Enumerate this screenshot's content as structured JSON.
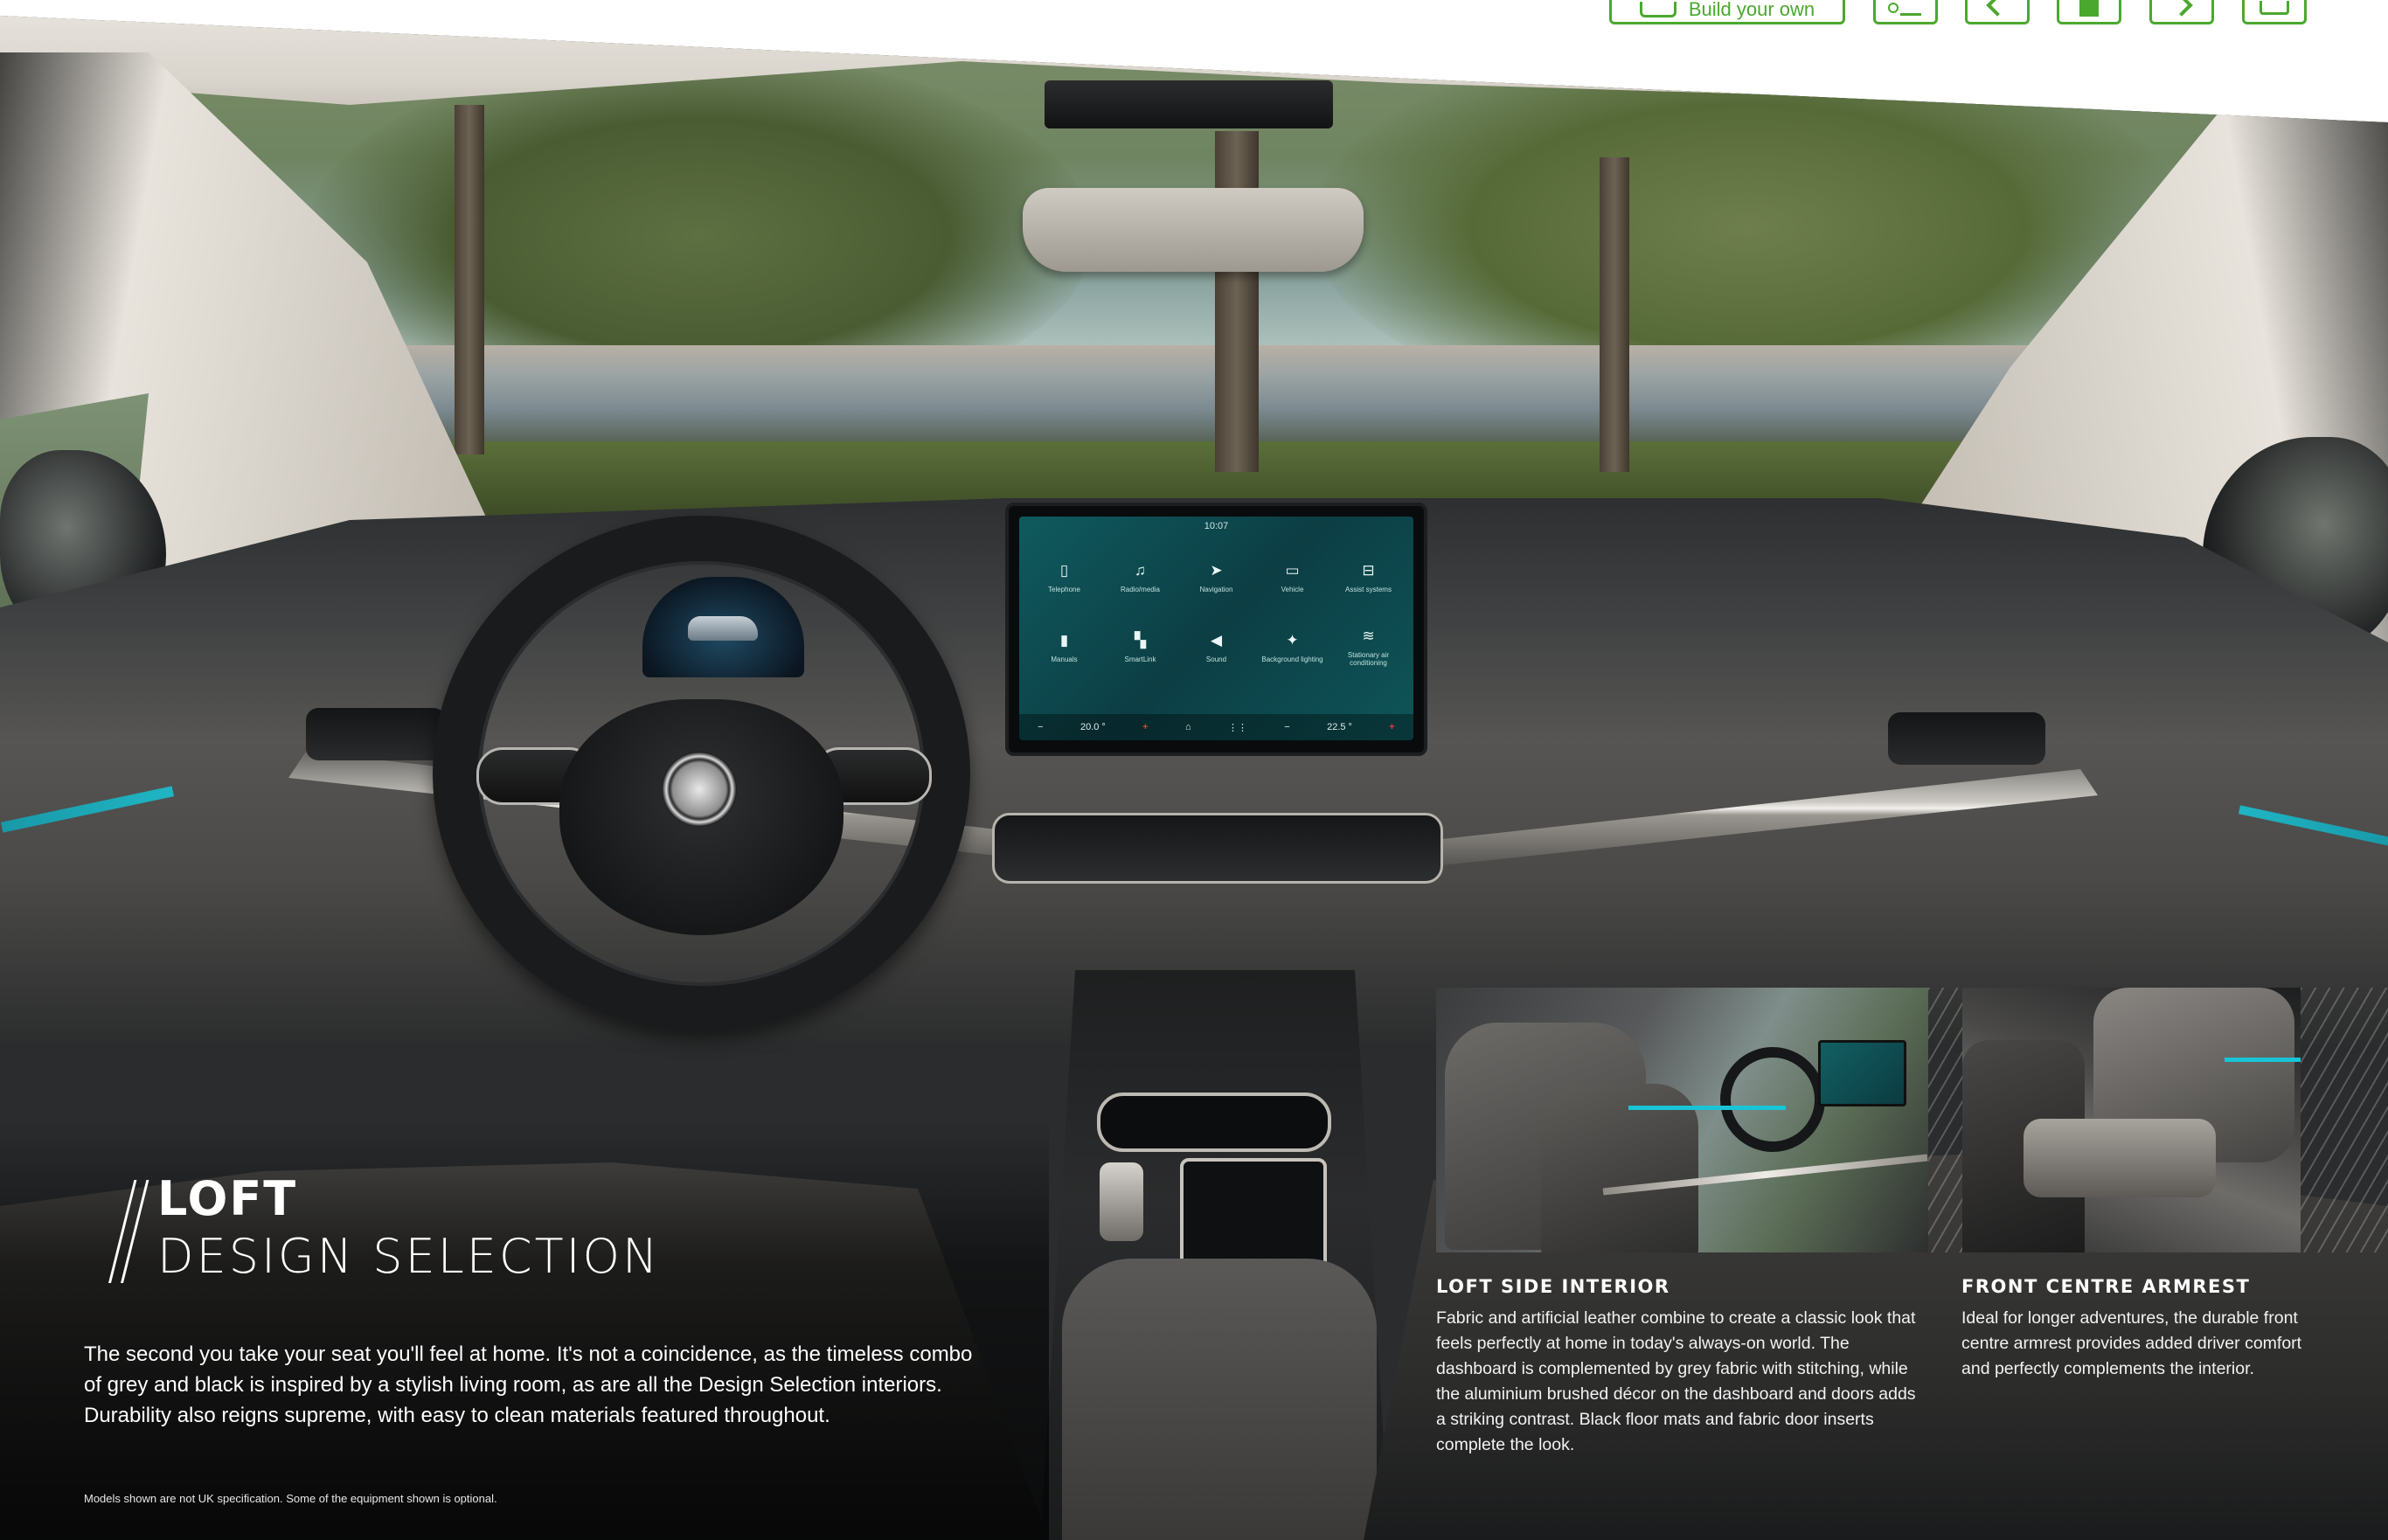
{
  "toolbar": {
    "build_label": "Build your own",
    "buttons": [
      "list",
      "back",
      "save",
      "next",
      "print"
    ]
  },
  "hero": {
    "title_bold": "LOFT",
    "title_light": "DESIGN SELECTION",
    "body": "The second you take your seat you'll feel at home. It's not a coincidence, as the timeless combo of grey and black is inspired by a stylish living room, as are all the Design Selection interiors. Durability also reigns supreme, with easy to clean materials featured throughout.",
    "footnote": "Models shown are not UK specification. Some of the equipment shown is optional."
  },
  "screen": {
    "time": "10:07",
    "tiles": [
      {
        "icon": "phone-icon",
        "label": "Telephone"
      },
      {
        "icon": "music-icon",
        "label": "Radio/media"
      },
      {
        "icon": "navigation-icon",
        "label": "Navigation"
      },
      {
        "icon": "car-icon",
        "label": "Vehicle"
      },
      {
        "icon": "assist-icon",
        "label": "Assist systems"
      },
      {
        "icon": "manuals-icon",
        "label": "Manuals"
      },
      {
        "icon": "smartlink-icon",
        "label": "SmartLink"
      },
      {
        "icon": "sound-icon",
        "label": "Sound"
      },
      {
        "icon": "lighting-icon",
        "label": "Background lighting"
      },
      {
        "icon": "aircon-icon",
        "label": "Stationary air conditioning"
      }
    ],
    "temp_left": "20.0 °",
    "temp_right": "22.5 °"
  },
  "captions": [
    {
      "heading": "LOFT SIDE INTERIOR",
      "body": "Fabric and artificial leather combine to create a classic look that feels perfectly at home in today's always-on world. The dashboard is complemented by grey fabric with stitching, while the aluminium brushed décor on the dashboard and doors adds a striking contrast. Black floor mats and fabric door inserts complete the look."
    },
    {
      "heading": "FRONT CENTRE ARMREST",
      "body": "Ideal for longer adventures, the durable front centre armrest provides added driver comfort and perfectly complements the interior."
    }
  ],
  "colors": {
    "accent_green": "#4ba82e",
    "ambient_cyan": "#17c7d9"
  }
}
